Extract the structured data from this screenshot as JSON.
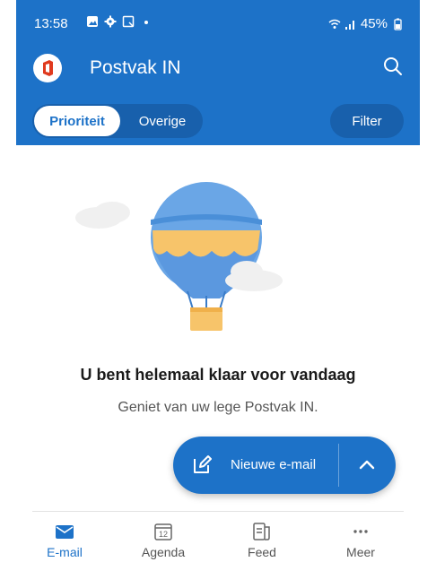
{
  "status_bar": {
    "time": "13:58",
    "battery": "45%"
  },
  "header": {
    "title": "Postvak IN",
    "tabs": [
      {
        "label": "Prioriteit",
        "active": true
      },
      {
        "label": "Overige",
        "active": false
      }
    ],
    "filter_label": "Filter"
  },
  "empty_state": {
    "title": "U bent helemaal klaar voor vandaag",
    "subtitle": "Geniet van uw lege Postvak IN."
  },
  "fab": {
    "label": "Nieuwe e-mail"
  },
  "bottom_nav": [
    {
      "label": "E-mail",
      "icon": "mail-icon",
      "active": true
    },
    {
      "label": "Agenda",
      "icon": "calendar-icon",
      "active": false,
      "badge": "12"
    },
    {
      "label": "Feed",
      "icon": "feed-icon",
      "active": false
    },
    {
      "label": "Meer",
      "icon": "more-icon",
      "active": false
    }
  ],
  "colors": {
    "brand": "#1d72c8",
    "brand_dark": "#1860ac",
    "logo_red": "#e03a1e"
  }
}
